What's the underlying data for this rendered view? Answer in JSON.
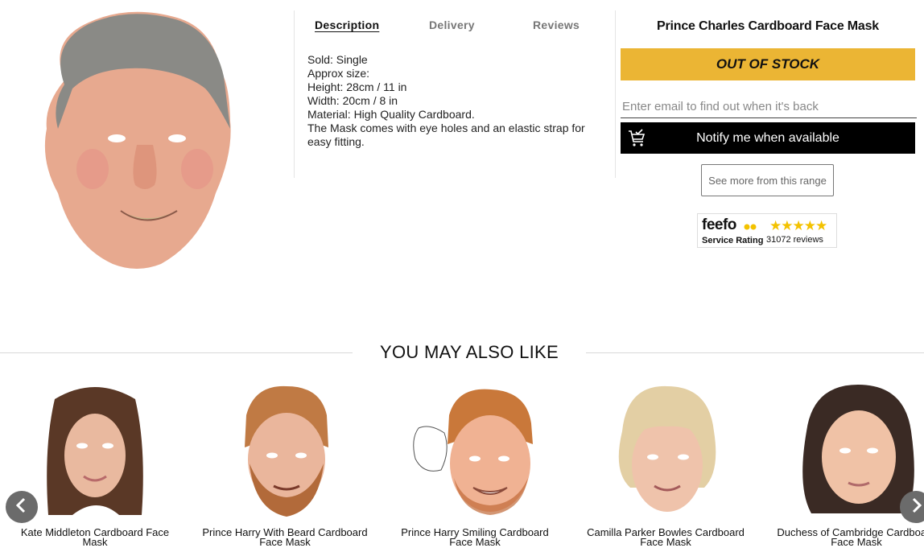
{
  "product": {
    "title": "Prince Charles Cardboard Face Mask",
    "image_alt": "Prince Charles face mask"
  },
  "tabs": [
    {
      "label": "Description",
      "active": true
    },
    {
      "label": "Delivery",
      "active": false
    },
    {
      "label": "Reviews",
      "active": false
    }
  ],
  "description": {
    "lines": [
      "Sold: Single",
      "Approx size:",
      "Height: 28cm / 11 in",
      "Width: 20cm / 8 in",
      "Material: High Quality Cardboard.",
      "The Mask comes with eye holes and an elastic strap for easy fitting."
    ]
  },
  "stock": {
    "status_label": "OUT OF STOCK",
    "color": "#ebb534"
  },
  "notify": {
    "email_placeholder": "Enter email to find out when it's back",
    "button_label": "Notify me when available",
    "icon": "cart-check-icon"
  },
  "more_button_label": "See more from this range",
  "feefo": {
    "logo": "feefo",
    "service_label": "Service Rating",
    "stars": "★★★★★",
    "reviews": "31072 reviews"
  },
  "related": {
    "heading": "YOU MAY ALSO LIKE",
    "items": [
      {
        "line1": "Kate Middleton Cardboard Face",
        "line2": "Mask"
      },
      {
        "line1": "Prince Harry With Beard Cardboard",
        "line2": "Face Mask"
      },
      {
        "line1": "Prince Harry Smiling Cardboard",
        "line2": "Face Mask"
      },
      {
        "line1": "Camilla Parker Bowles Cardboard",
        "line2": "Face Mask"
      },
      {
        "line1": "Duchess of Cambridge Cardboard",
        "line2": "Face Mask"
      }
    ]
  }
}
